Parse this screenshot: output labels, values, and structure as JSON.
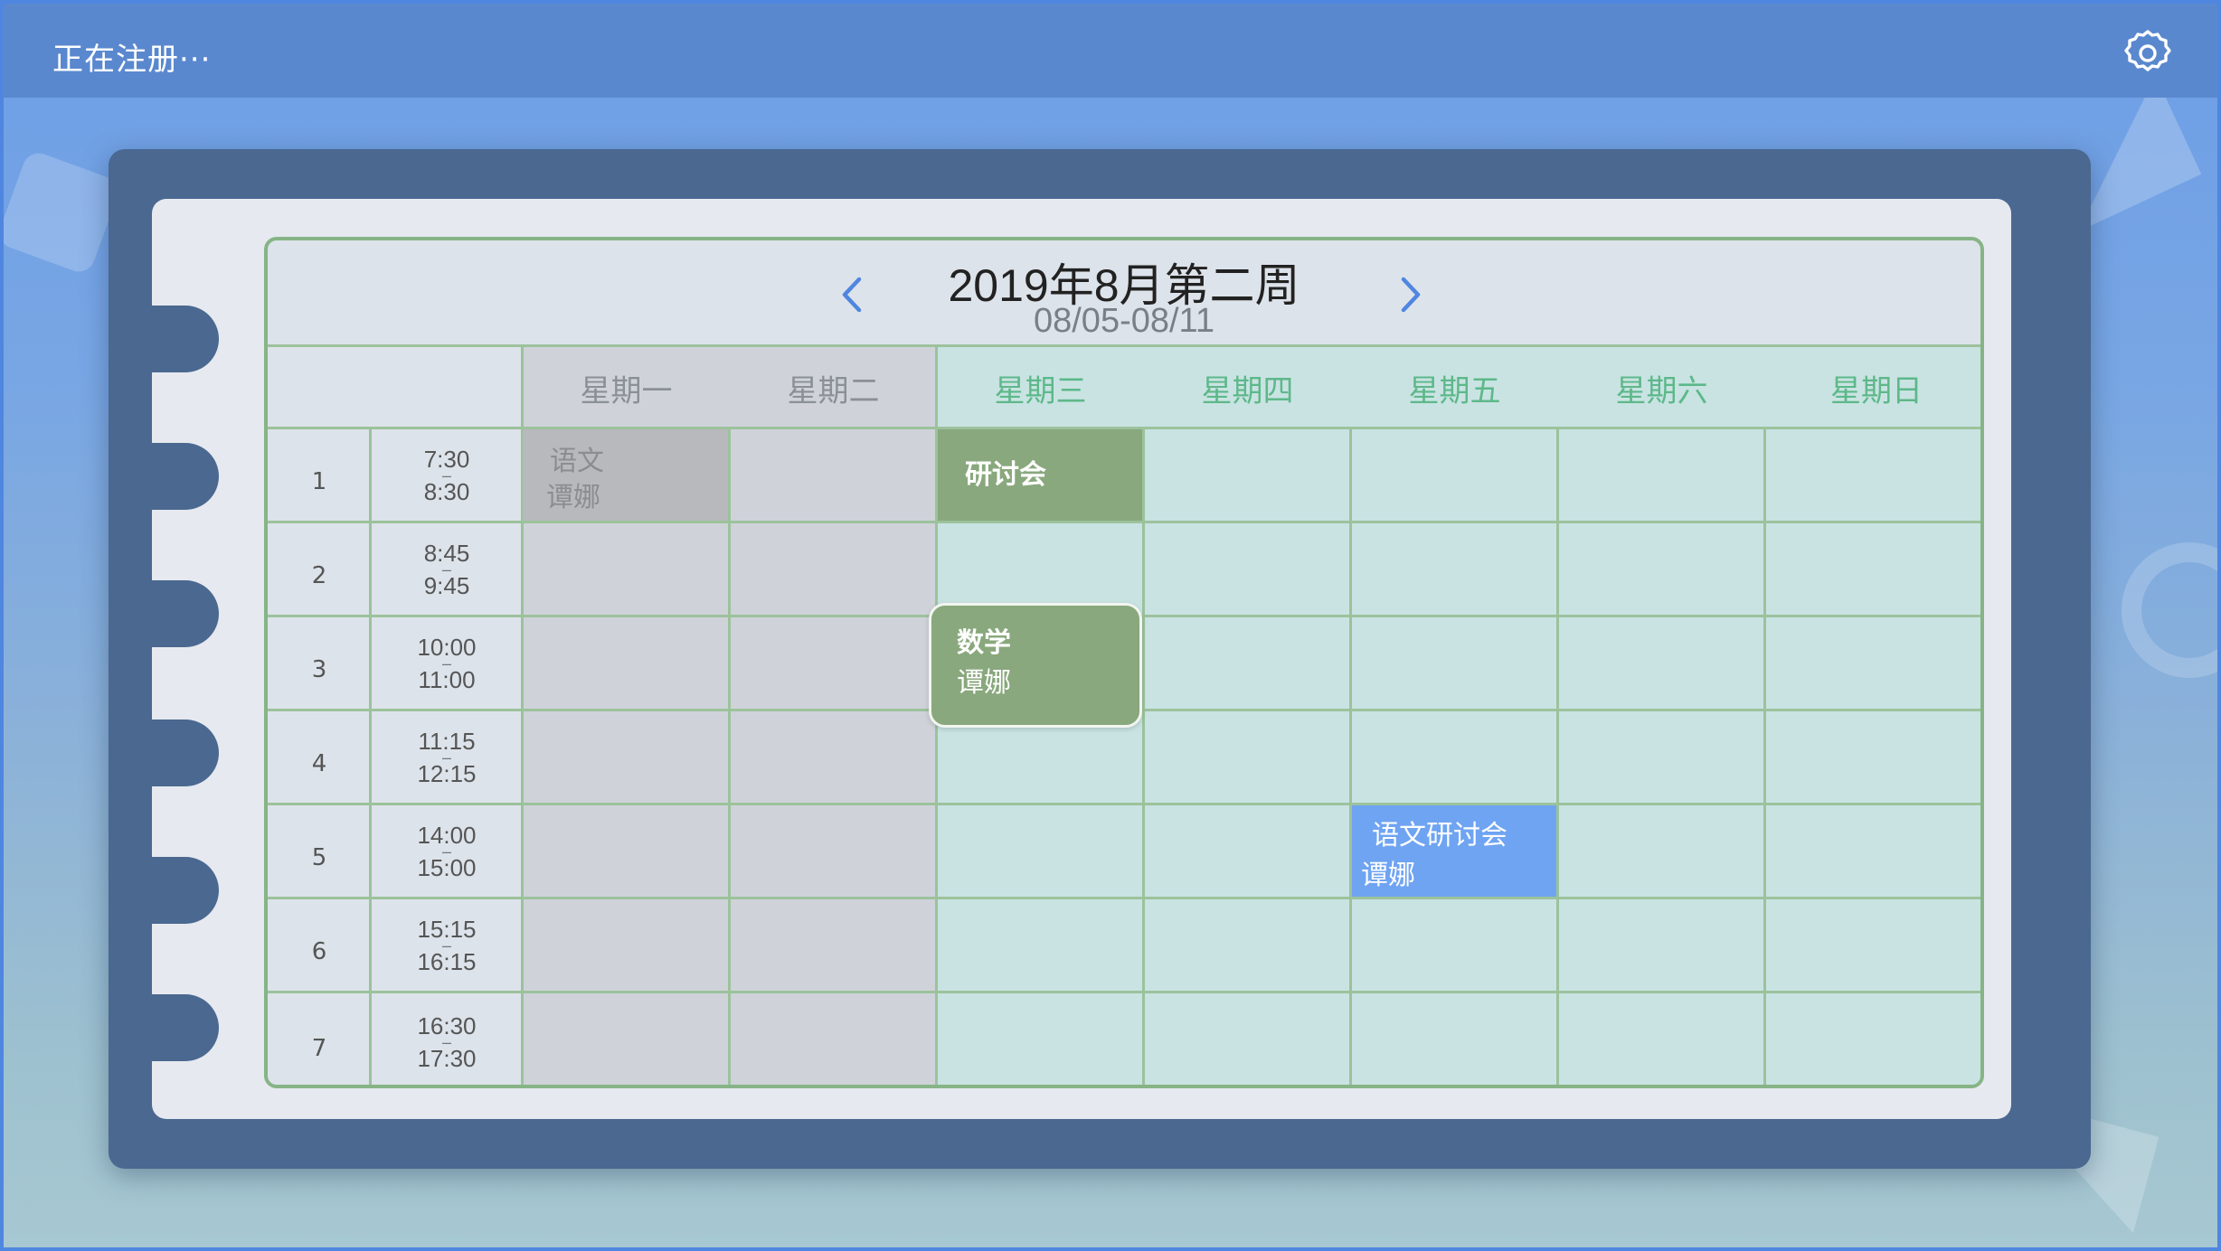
{
  "app": {
    "title": "正在注册···"
  },
  "icons": {
    "settings": "gear-icon",
    "prev": "chevron-left-icon",
    "next": "chevron-right-icon"
  },
  "colors": {
    "accent": "#4f86e0",
    "topbar": "#5a88cf",
    "event_green": "#89a87d",
    "event_blue": "#6fa4f2",
    "event_past": "#b7b9bc",
    "future_day_text": "#5db88a"
  },
  "calendar": {
    "week_title": "2019年8月第二周",
    "week_range": "08/05-08/11",
    "days": [
      {
        "label": "星期一",
        "state": "past"
      },
      {
        "label": "星期二",
        "state": "past"
      },
      {
        "label": "星期三",
        "state": "future"
      },
      {
        "label": "星期四",
        "state": "future"
      },
      {
        "label": "星期五",
        "state": "future"
      },
      {
        "label": "星期六",
        "state": "future"
      },
      {
        "label": "星期日",
        "state": "future"
      }
    ],
    "periods": [
      {
        "num": "1",
        "start": "7:30",
        "end": "8:30"
      },
      {
        "num": "2",
        "start": "8:45",
        "end": "9:45"
      },
      {
        "num": "3",
        "start": "10:00",
        "end": "11:00"
      },
      {
        "num": "4",
        "start": "11:15",
        "end": "12:15"
      },
      {
        "num": "5",
        "start": "14:00",
        "end": "15:00"
      },
      {
        "num": "6",
        "start": "15:15",
        "end": "16:15"
      },
      {
        "num": "7",
        "start": "16:30",
        "end": "17:30"
      }
    ],
    "time_separator": "–",
    "events": {
      "mon_p1": {
        "subject": "语文",
        "teacher": "谭娜",
        "day": "星期一",
        "period": "1"
      },
      "wed_p1": {
        "subject": "研讨会",
        "day": "星期三",
        "period": "1"
      },
      "wed_p3": {
        "subject": "数学",
        "teacher": "谭娜",
        "day": "星期三",
        "period": "3"
      },
      "fri_p5": {
        "subject": "语文研讨会",
        "teacher": "谭娜",
        "day": "星期五",
        "period": "5"
      }
    }
  }
}
